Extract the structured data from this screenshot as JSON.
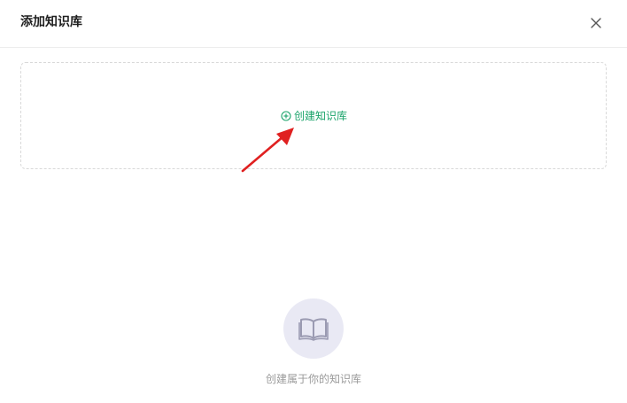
{
  "dialog": {
    "title": "添加知识库",
    "close_icon": "close-icon"
  },
  "dropzone": {
    "create_label": "创建知识库",
    "create_icon": "plus-circle-icon",
    "accent_color": "#1aa36a"
  },
  "annotation": {
    "arrow_color": "#e02020"
  },
  "empty_state": {
    "icon": "open-book-icon",
    "text": "创建属于你的知识库"
  }
}
